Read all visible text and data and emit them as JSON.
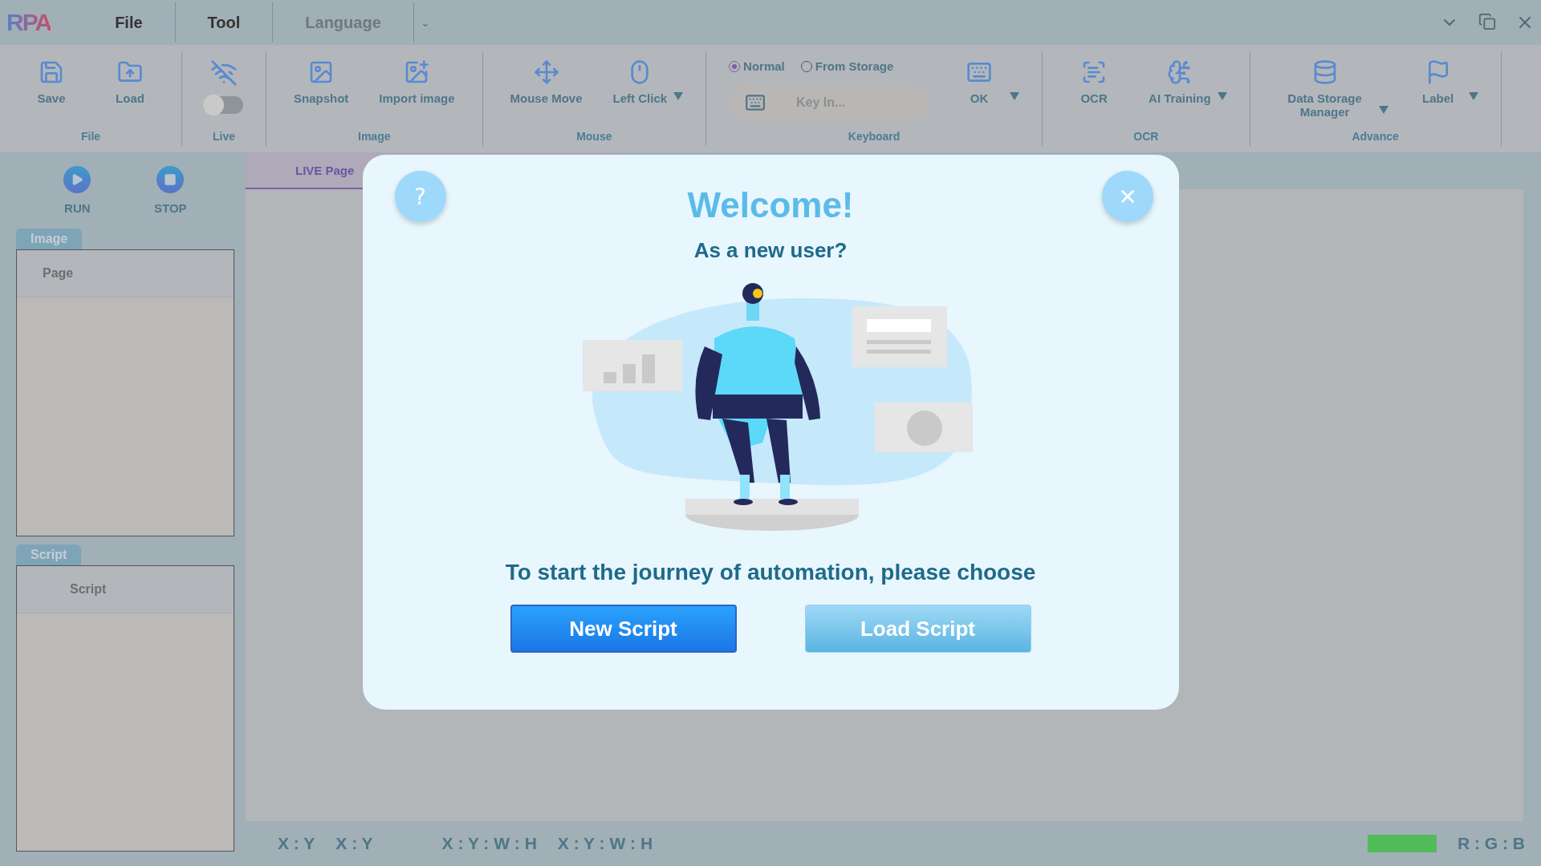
{
  "title_bar": {
    "logo": "RPA",
    "menu": [
      {
        "label": "File",
        "disabled": false
      },
      {
        "label": "Tool",
        "disabled": false
      },
      {
        "label": "Language",
        "disabled": true
      }
    ],
    "menu_caret": "⌄"
  },
  "ribbon": [
    {
      "label": "File",
      "items": [
        {
          "kind": "button",
          "label": "Save",
          "dropdown": false
        },
        {
          "kind": "button",
          "label": "Load",
          "dropdown": false
        }
      ]
    },
    {
      "label": "Live",
      "items": [
        {
          "kind": "toggle",
          "on": false
        }
      ]
    },
    {
      "label": "Image",
      "items": [
        {
          "kind": "button",
          "label": "Snapshot",
          "dropdown": false
        },
        {
          "kind": "button",
          "label": "Import image",
          "dropdown": false
        }
      ]
    },
    {
      "label": "Mouse",
      "items": [
        {
          "kind": "button",
          "label": "Mouse Move",
          "dropdown": false
        },
        {
          "kind": "button",
          "label": "Left Click",
          "dropdown": true
        }
      ]
    },
    {
      "label": "Keyboard",
      "items": [
        {
          "kind": "keyboard",
          "radios": [
            {
              "label": "Normal",
              "selected": true
            },
            {
              "label": "From Storage",
              "selected": false
            }
          ],
          "placeholder": "Key In..."
        },
        {
          "kind": "button",
          "label": "OK",
          "dropdown": true
        }
      ]
    },
    {
      "label": "OCR",
      "items": [
        {
          "kind": "button",
          "label": "OCR",
          "dropdown": false
        },
        {
          "kind": "button",
          "label": "AI Training",
          "dropdown": true
        }
      ]
    },
    {
      "label": "Advance",
      "items": [
        {
          "kind": "button",
          "label": "Data Storage Manager",
          "dropdown": true
        },
        {
          "kind": "button",
          "label": "Label",
          "dropdown": true
        }
      ]
    }
  ],
  "sidebar": {
    "controls": [
      {
        "label": "RUN"
      },
      {
        "label": "STOP"
      }
    ],
    "panels": [
      {
        "tab": "Image",
        "header": "Page"
      },
      {
        "tab": "Script",
        "header": "Script"
      }
    ]
  },
  "tabs": [
    {
      "label": "LIVE Page",
      "selected": true
    }
  ],
  "status_bar": {
    "coordinates": [
      "X : Y",
      "X : Y",
      "X : Y : W : H",
      "X : Y : W : H"
    ],
    "color": "#52bb5a",
    "color_label": "R : G : B"
  },
  "dialog": {
    "help": "?",
    "title": "Welcome!",
    "subtitle": "As a new user?",
    "prompt": "To start the journey of automation, please choose",
    "buttons": [
      {
        "label": "New Script",
        "kind": "primary"
      },
      {
        "label": "Load Script",
        "kind": "secondary"
      }
    ]
  }
}
